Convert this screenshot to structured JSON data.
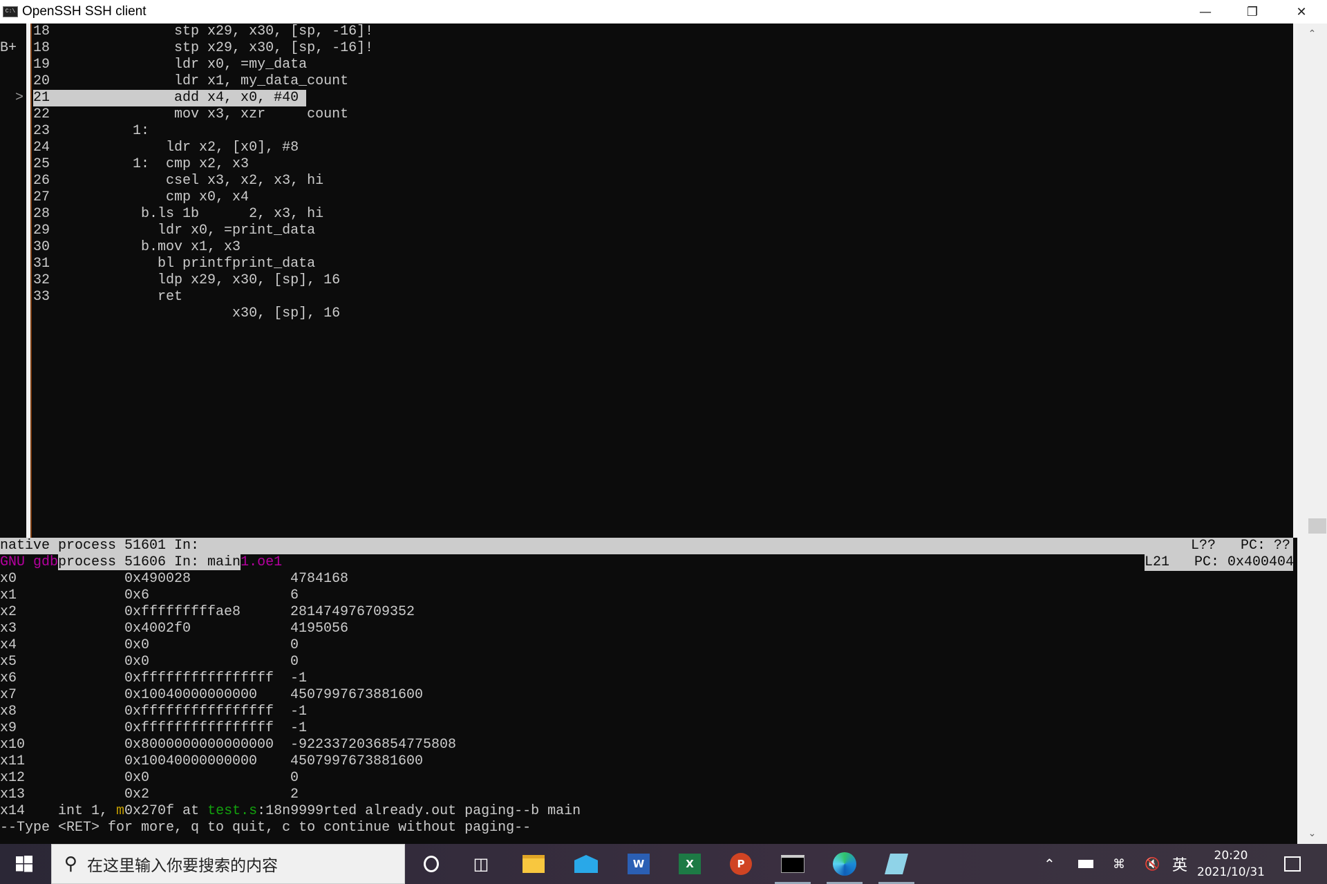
{
  "window": {
    "title": "OpenSSH SSH client",
    "icon": "console-icon",
    "controls": [
      "minimize-icon",
      "restore-icon",
      "close-icon"
    ]
  },
  "gutter": {
    "breakpoint_marker": "B+",
    "current_marker": ">"
  },
  "source": {
    "lines": [
      {
        "num": "18",
        "code": "               stp x29, x30, [sp, -16]!"
      },
      {
        "num": "18",
        "code": "               stp x29, x30, [sp, -16]!"
      },
      {
        "num": "19",
        "code": "               ldr x0, =my_data"
      },
      {
        "num": "20",
        "code": "               ldr x1, my_data_count"
      },
      {
        "num": "21",
        "code": "               add x4, x0, #40"
      },
      {
        "num": "22",
        "code": "               mov x3, xzr     count"
      },
      {
        "num": "23",
        "code": "          1:"
      },
      {
        "num": "24",
        "code": "              ldr x2, [x0], #8"
      },
      {
        "num": "25",
        "code": "          1:  cmp x2, x3"
      },
      {
        "num": "26",
        "code": "              csel x3, x2, x3, hi"
      },
      {
        "num": "27",
        "code": "              cmp x0, x4"
      },
      {
        "num": "28",
        "code": "           b.ls 1b      2, x3, hi"
      },
      {
        "num": "29",
        "code": "             ldr x0, =print_data"
      },
      {
        "num": "30",
        "code": "           b.mov x1, x3"
      },
      {
        "num": "31",
        "code": "             bl printfprint_data"
      },
      {
        "num": "32",
        "code": "             ldp x29, x30, [sp], 16"
      },
      {
        "num": "33",
        "code": "             ret"
      },
      {
        "num": "",
        "code": "                      x30, [sp], 16"
      }
    ]
  },
  "status": {
    "line1_left": "native process 51601 In:",
    "line1_right": "L??   PC: ??",
    "line2_gdb": "GNU gdb",
    "line2_left": "process 51606 In: main",
    "line2_tail": "1.oe1",
    "line2_right": "L21   PC: 0x400404"
  },
  "registers": [
    {
      "name": "x0",
      "hex": "0x490028",
      "dec": "4784168"
    },
    {
      "name": "x1",
      "hex": "0x6",
      "dec": "6"
    },
    {
      "name": "x2",
      "hex": "0xfffffffffae8",
      "dec": "281474976709352"
    },
    {
      "name": "x3",
      "hex": "0x4002f0",
      "dec": "4195056"
    },
    {
      "name": "x4",
      "hex": "0x0",
      "dec": "0"
    },
    {
      "name": "x5",
      "hex": "0x0",
      "dec": "0"
    },
    {
      "name": "x6",
      "hex": "0xffffffffffffffff",
      "dec": "-1"
    },
    {
      "name": "x7",
      "hex": "0x10040000000000",
      "dec": "4507997673881600"
    },
    {
      "name": "x8",
      "hex": "0xffffffffffffffff",
      "dec": "-1"
    },
    {
      "name": "x9",
      "hex": "0xffffffffffffffff",
      "dec": "-1"
    },
    {
      "name": "x10",
      "hex": "0x8000000000000000",
      "dec": "-9223372036854775808"
    },
    {
      "name": "x11",
      "hex": "0x10040000000000",
      "dec": "4507997673881600"
    },
    {
      "name": "x12",
      "hex": "0x0",
      "dec": "0"
    },
    {
      "name": "x13",
      "hex": "0x2",
      "dec": "2"
    }
  ],
  "x14_line": {
    "a": "x14    int 1, ",
    "b": "m",
    "c": "0x270f at ",
    "d": "test.s",
    "e": ":18n9999rted already.out paging--b main"
  },
  "pager": "--Type <RET> for more, q to quit, c to continue without paging--",
  "taskbar": {
    "search_placeholder": "在这里输入你要搜索的内容",
    "apps": [
      "cortana-icon",
      "task-view-icon",
      "file-explorer-icon",
      "mail-icon",
      "word-icon",
      "excel-icon",
      "powerpoint-icon",
      "terminal-icon",
      "edge-icon",
      "notepad-icon"
    ],
    "ime": "英",
    "time": "20:20",
    "date": "2021/10/31"
  },
  "colors": {
    "terminal_bg": "#0c0c0c",
    "terminal_fg": "#cccccc",
    "highlight": "#cccccc",
    "gdb_magenta": "#b4009e",
    "green": "#13a10e"
  }
}
